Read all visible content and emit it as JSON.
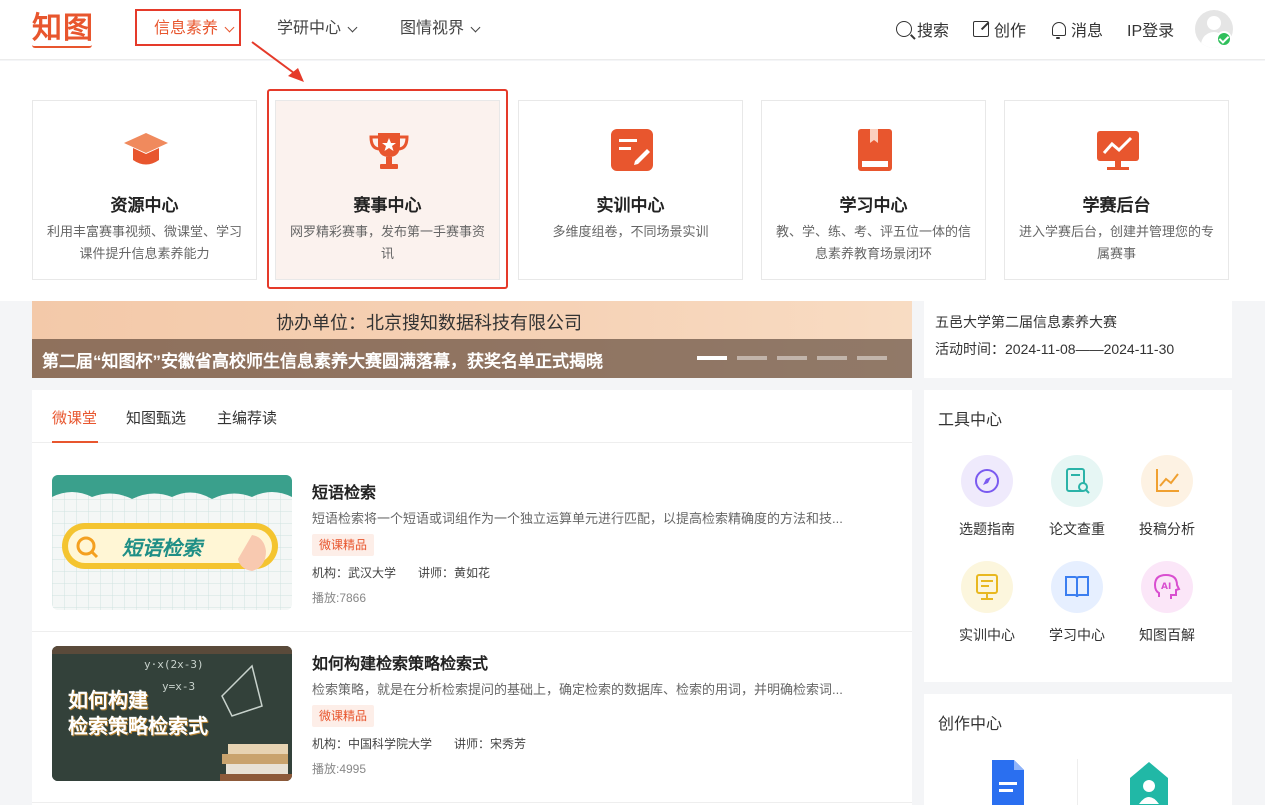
{
  "header": {
    "logo": "知图",
    "nav": [
      {
        "label": "信息素养",
        "active": true
      },
      {
        "label": "学研中心",
        "active": false
      },
      {
        "label": "图情视界",
        "active": false
      }
    ],
    "tools": {
      "search": "搜索",
      "create": "创作",
      "message": "消息",
      "login": "IP登录"
    }
  },
  "dropdown": {
    "cards": [
      {
        "title": "资源中心",
        "desc": "利用丰富赛事视频、微课堂、学习课件提升信息素养能力",
        "icon": "graduation-cap-icon"
      },
      {
        "title": "赛事中心",
        "desc": "网罗精彩赛事，发布第一手赛事资讯",
        "icon": "trophy-icon"
      },
      {
        "title": "实训中心",
        "desc": "多维度组卷，不同场景实训",
        "icon": "edit-document-icon"
      },
      {
        "title": "学习中心",
        "desc": "教、学、练、考、评五位一体的信息素养教育场景闭环",
        "icon": "book-icon"
      },
      {
        "title": "学赛后台",
        "desc": "进入学赛后台，创建并管理您的专属赛事",
        "icon": "monitor-chart-icon"
      }
    ]
  },
  "banner": {
    "subtitle": "协办单位：北京搜知数据科技有限公司",
    "caption": "第二届“知图杯”安徽省高校师生信息素养大赛圆满落幕，获奖名单正式揭晓"
  },
  "event": {
    "name": "五邑大学第二届信息素养大赛",
    "time": "活动时间：2024-11-08——2024-11-30"
  },
  "courses": {
    "tabs": [
      "微课堂",
      "知图甄选",
      "主编荐读"
    ],
    "items": [
      {
        "title": "短语检索",
        "desc": "短语检索将一个短语或词组作为一个独立运算单元进行匹配，以提高检索精确度的方法和技...",
        "tag": "微课精品",
        "org": "机构：武汉大学",
        "lecturer": "讲师：黄如花",
        "plays": "播放:7866",
        "thumb_text": "短语检索"
      },
      {
        "title": "如何构建检索策略检索式",
        "desc": "检索策略，就是在分析检索提问的基础上，确定检索的数据库、检索的用词，并明确检索词...",
        "tag": "微课精品",
        "org": "机构：中国科学院大学",
        "lecturer": "讲师：宋秀芳",
        "plays": "播放:4995",
        "thumb_line1": "如何构建",
        "thumb_line2": "检索策略检索式"
      }
    ]
  },
  "tools": {
    "title": "工具中心",
    "items": [
      {
        "label": "选题指南",
        "color": "#7a5af0",
        "bg": "#efeafc"
      },
      {
        "label": "论文查重",
        "color": "#2bb3a8",
        "bg": "#e6f6f4"
      },
      {
        "label": "投稿分析",
        "color": "#f0a030",
        "bg": "#fdf2e3"
      },
      {
        "label": "实训中心",
        "color": "#e8b820",
        "bg": "#fcf6dd"
      },
      {
        "label": "学习中心",
        "color": "#3b7ef0",
        "bg": "#e6efff"
      },
      {
        "label": "知图百解",
        "color": "#d94fd0",
        "bg": "#fbe6f8"
      }
    ]
  },
  "create": {
    "title": "创作中心"
  },
  "colors": {
    "brand": "#e8562e",
    "highlight": "#e53a2a"
  }
}
